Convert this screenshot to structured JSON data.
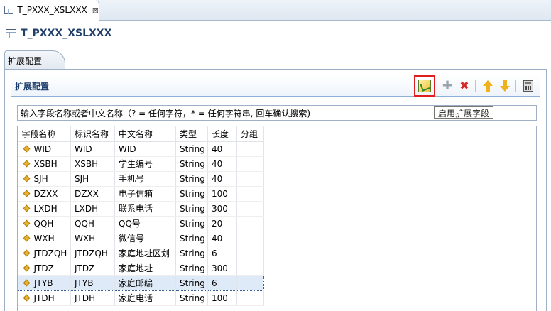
{
  "editor_tab": {
    "title": "T_PXXX_XSLXXX",
    "close_glyph": "⊠",
    "icon": "table-icon"
  },
  "title_bar": {
    "title": "T_PXXX_XSLXXX",
    "icon": "table-icon"
  },
  "section_tab": {
    "label": "扩展配置"
  },
  "group": {
    "title": "扩展配置"
  },
  "toolbar": {
    "enable_icon": "enable-extension-icon",
    "add_icon": "add-icon",
    "delete_icon": "delete-icon",
    "up_icon": "move-up-icon",
    "down_icon": "move-down-icon",
    "calc_icon": "calculator-icon"
  },
  "tooltip": {
    "text": "启用扩展字段"
  },
  "search": {
    "placeholder": "输入字段名称或者中文名称（? = 任何字符，* = 任何字符串, 回车确认搜索)"
  },
  "table": {
    "columns": [
      "字段名称",
      "标识名称",
      "中文名称",
      "类型",
      "长度",
      "分组"
    ],
    "rows": [
      [
        "WID",
        "WID",
        "WID",
        "String",
        "40",
        ""
      ],
      [
        "XSBH",
        "XSBH",
        "学生编号",
        "String",
        "40",
        ""
      ],
      [
        "SJH",
        "SJH",
        "手机号",
        "String",
        "40",
        ""
      ],
      [
        "DZXX",
        "DZXX",
        "电子信箱",
        "String",
        "100",
        ""
      ],
      [
        "LXDH",
        "LXDH",
        "联系电话",
        "String",
        "300",
        ""
      ],
      [
        "QQH",
        "QQH",
        "QQ号",
        "String",
        "20",
        ""
      ],
      [
        "WXH",
        "WXH",
        "微信号",
        "String",
        "40",
        ""
      ],
      [
        "JTDZQH",
        "JTDZQH",
        "家庭地址区划",
        "String",
        "6",
        ""
      ],
      [
        "JTDZ",
        "JTDZ",
        "家庭地址",
        "String",
        "300",
        ""
      ],
      [
        "JTYB",
        "JTYB",
        "家庭邮编",
        "String",
        "6",
        ""
      ],
      [
        "JTDH",
        "JTDH",
        "家庭电话",
        "String",
        "100",
        ""
      ]
    ],
    "selected_index": 9
  },
  "colors": {
    "accent": "#1f3f6a",
    "highlight_box": "#e01e1e",
    "selection": "#dfeaf8"
  }
}
